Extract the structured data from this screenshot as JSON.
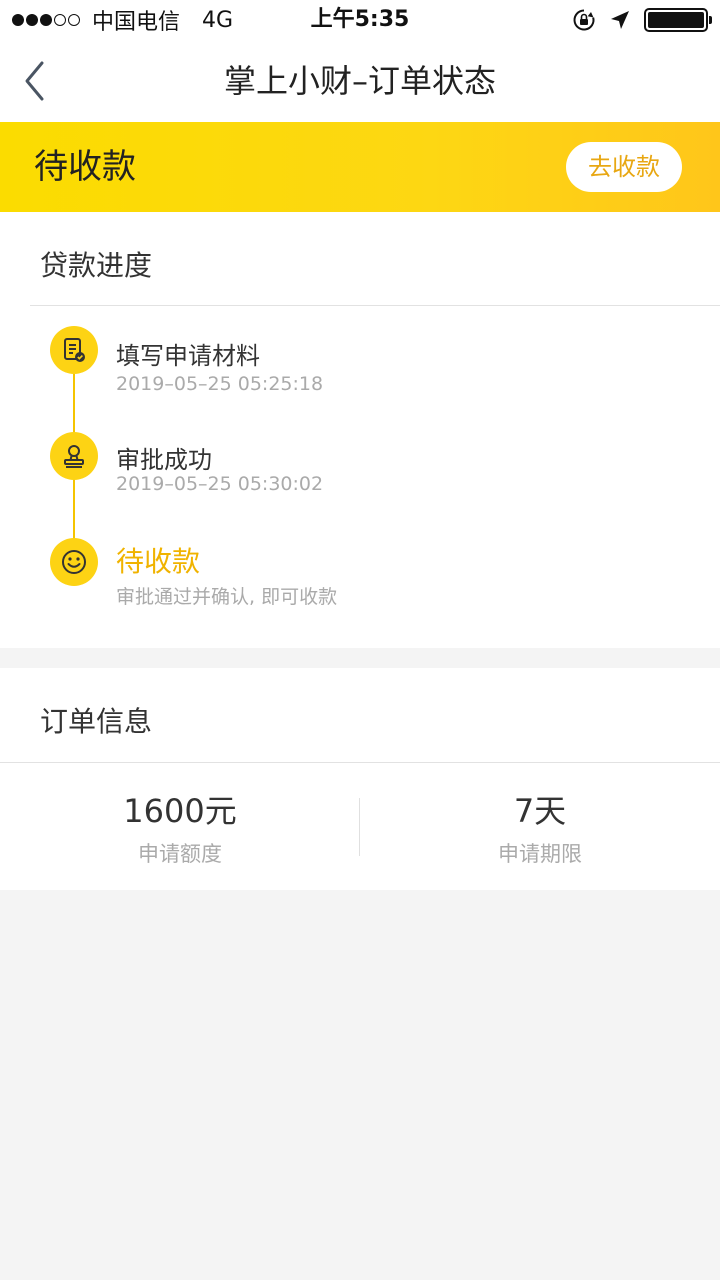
{
  "status_bar": {
    "carrier": "中国电信",
    "network": "4G",
    "time": "上午5:35",
    "signal_bars_filled": 3,
    "signal_bars_total": 5,
    "battery_level": 1.0
  },
  "nav": {
    "title": "掌上小财–订单状态",
    "back_icon": "chevron-left-icon"
  },
  "banner": {
    "status": "待收款",
    "action_label": "去收款",
    "accent_color": "#fdd314"
  },
  "progress": {
    "title": "贷款进度",
    "steps": [
      {
        "icon": "document-check-icon",
        "title": "填写申请材料",
        "subtitle": "2019–05–25 05:25:18"
      },
      {
        "icon": "stamp-icon",
        "title": "审批成功",
        "subtitle": "2019–05–25 05:30:02"
      },
      {
        "icon": "smile-icon",
        "title": "待收款",
        "subtitle": "审批通过并确认, 即可收款",
        "active": true
      }
    ]
  },
  "order": {
    "title": "订单信息",
    "amount_value": "1600元",
    "amount_label": "申请额度",
    "term_value": "7天",
    "term_label": "申请期限"
  }
}
